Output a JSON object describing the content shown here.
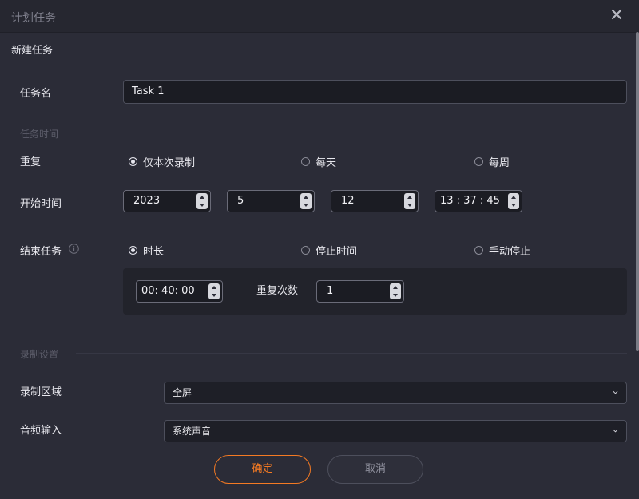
{
  "window": {
    "title": "计划任务",
    "close_icon": "close-icon"
  },
  "section_title": "新建任务",
  "task_name": {
    "label": "任务名",
    "value": "Task 1"
  },
  "task_time_group": "任务时间",
  "repeat": {
    "label": "重复",
    "options": [
      {
        "label": "仅本次录制",
        "selected": true
      },
      {
        "label": "每天",
        "selected": false
      },
      {
        "label": "每周",
        "selected": false
      }
    ]
  },
  "start_time": {
    "label": "开始时间",
    "year": "2023",
    "month": "5",
    "day": "12",
    "time": "13 : 37 : 45"
  },
  "end_task": {
    "label": "结束任务",
    "info_icon": "info-icon",
    "options": [
      {
        "label": "时长",
        "selected": true
      },
      {
        "label": "停止时间",
        "selected": false
      },
      {
        "label": "手动停止",
        "selected": false
      }
    ],
    "duration": "00: 40: 00",
    "repeat_count_label": "重复次数",
    "repeat_count": "1"
  },
  "record_settings_group": "录制设置",
  "record_area": {
    "label": "录制区域",
    "value": "全屏"
  },
  "audio_input": {
    "label": "音频输入",
    "value": "系统声音"
  },
  "buttons": {
    "ok": "确定",
    "cancel": "取消"
  },
  "colors": {
    "accent": "#f47a23",
    "background": "#2b2c37",
    "input_bg": "#1b1c23"
  }
}
